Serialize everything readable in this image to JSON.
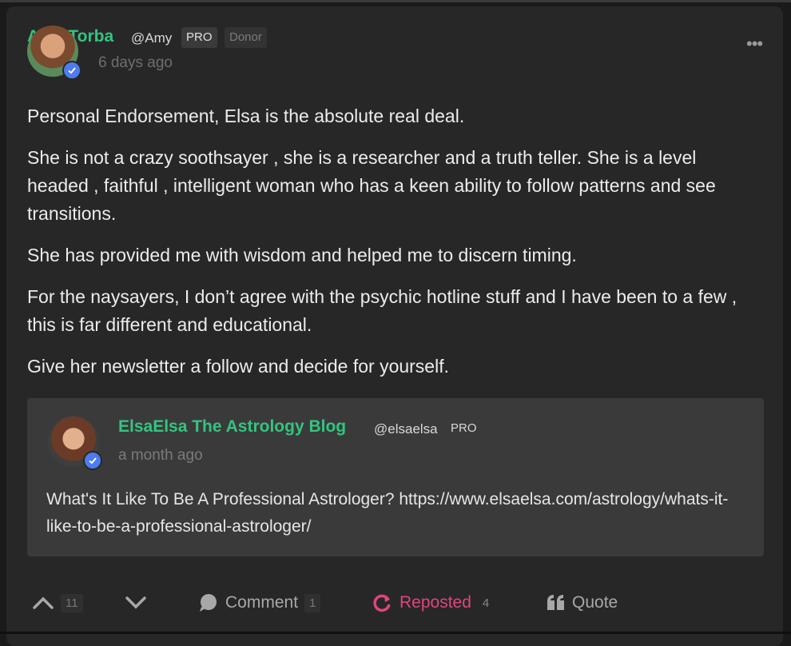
{
  "post": {
    "author_name": "Amy Torba",
    "author_handle": "@Amy",
    "badge_pro": "PRO",
    "badge_donor": "Donor",
    "time": "6 days ago",
    "more": "•••",
    "paragraphs": [
      "Personal Endorsement, Elsa is the absolute real deal.",
      "She is not a crazy soothsayer , she is a researcher and a truth teller.  She is a level headed , faithful , intelligent woman who has a keen ability to follow patterns and see transitions.",
      "She has provided me with wisdom and helped me to discern timing.",
      "For the naysayers, I don’t agree with the psychic hotline stuff and I have been to a few , this is far different and educational.",
      "Give her newsletter a follow and decide for yourself."
    ]
  },
  "quoted": {
    "author_name": "ElsaElsa The Astrology Blog",
    "author_handle": "@elsaelsa",
    "badge_pro": "PRO",
    "time": "a month ago",
    "text": "What's It Like To Be A Professional Astrologer? https://www.elsaelsa.com/astrology/whats-it-like-to-be-a-professional-astrologer/"
  },
  "actions": {
    "upvote_count": "11",
    "comment_label": "Comment",
    "comment_count": "1",
    "repost_label": "Reposted",
    "repost_count": "4",
    "quote_label": "Quote"
  },
  "colors": {
    "accent": "#33c481",
    "repost": "#e0457f",
    "verified": "#4e7bf0"
  }
}
